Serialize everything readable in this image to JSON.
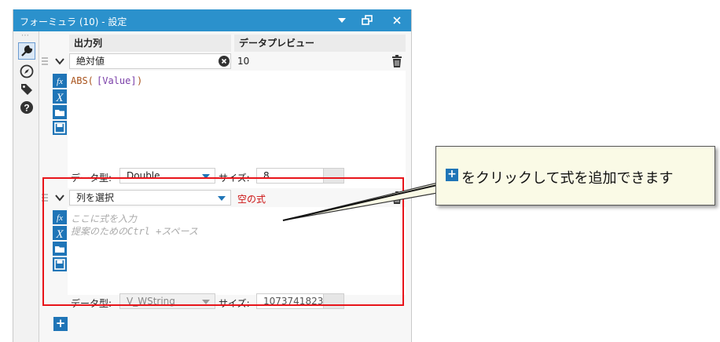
{
  "window": {
    "title": "フォーミュラ (10) - 設定",
    "dropdown_icon": "triangle-down",
    "undock_icon": "window-restore",
    "close_label": "×"
  },
  "tool_strip": {
    "handle": "⋯",
    "icons": [
      "wrench-icon",
      "compass-icon",
      "tag-icon",
      "help-icon"
    ]
  },
  "columns": {
    "output": "出力列",
    "preview": "データプレビュー"
  },
  "formula1": {
    "column": "絶対値",
    "preview": "10",
    "expression_func": "ABS(",
    "expression_arg": "[Value]",
    "expression_end": ")",
    "type_label": "データ型:",
    "type_value": "Double",
    "size_label": "サイズ:",
    "size_value": "8"
  },
  "formula2": {
    "column_placeholder": "列を選択",
    "preview": "空の式",
    "placeholder_line1": "ここに式を入力",
    "placeholder_line2": "提案のためのCtrl +スペース",
    "type_label": "データ型:",
    "type_value": "V_WString",
    "size_label": "サイズ:",
    "size_value": "1073741823"
  },
  "add_button": "+",
  "callout": {
    "text": "をクリックして式を追加できます"
  },
  "colors": {
    "titlebar": "#2b91cc",
    "highlight": "#e8141a",
    "accent_icon": "#1f75b7",
    "preview_empty": "#cc1111"
  }
}
